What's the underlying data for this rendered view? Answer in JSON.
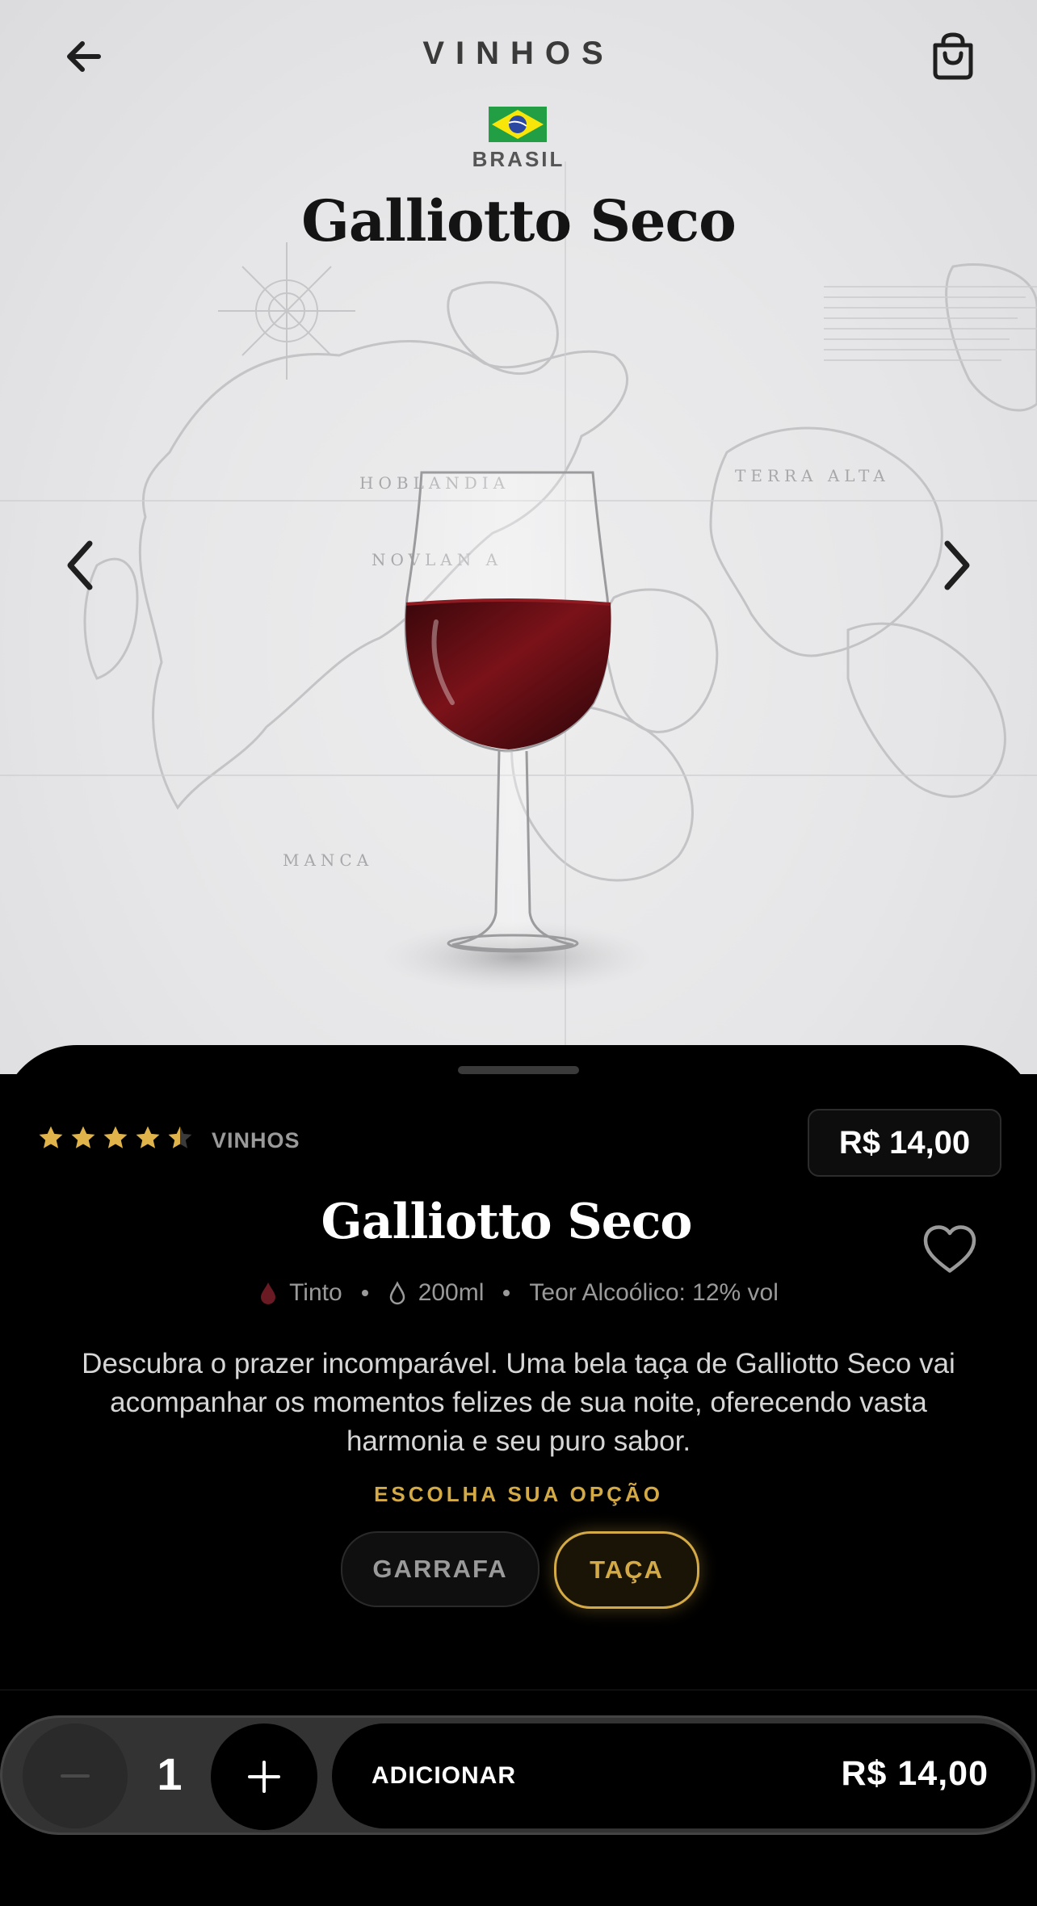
{
  "header": {
    "title": "VINHOS",
    "back_icon": "arrow-left-icon",
    "cart_icon": "shopping-bag-icon"
  },
  "hero": {
    "country": "BRASIL",
    "flag_icon": "brazil-flag-icon",
    "product_name": "Galliotto Seco",
    "map_labels": [
      "HOBLANDIA",
      "NOVLAN A",
      "TERRA ALTA",
      "MANCA"
    ],
    "prev_icon": "chevron-left-icon",
    "next_icon": "chevron-right-icon"
  },
  "product": {
    "rating": 4.5,
    "rating_max": 5,
    "category": "VINHOS",
    "price": "R$ 14,00",
    "name": "Galliotto Seco",
    "specs": {
      "type": "Tinto",
      "volume": "200ml",
      "alcohol": "Teor Alcoólico: 12% vol"
    },
    "description": "Descubra o prazer incomparável. Uma bela taça de Galliotto Seco vai acompanhar os momentos felizes de sua noite, oferecendo vasta harmonia e seu puro sabor.",
    "choose_label": "ESCOLHA SUA OPÇÃO",
    "options": [
      {
        "label": "GARRAFA",
        "selected": false
      },
      {
        "label": "TAÇA",
        "selected": true
      }
    ]
  },
  "cart_bar": {
    "quantity": "1",
    "add_label": "ADICIONAR",
    "total": "R$ 14,00"
  },
  "colors": {
    "accent_gold": "#d4aa46",
    "star_gold": "#e0b44a",
    "wine_red": "#5a0f14",
    "sheet_bg": "#000000"
  }
}
